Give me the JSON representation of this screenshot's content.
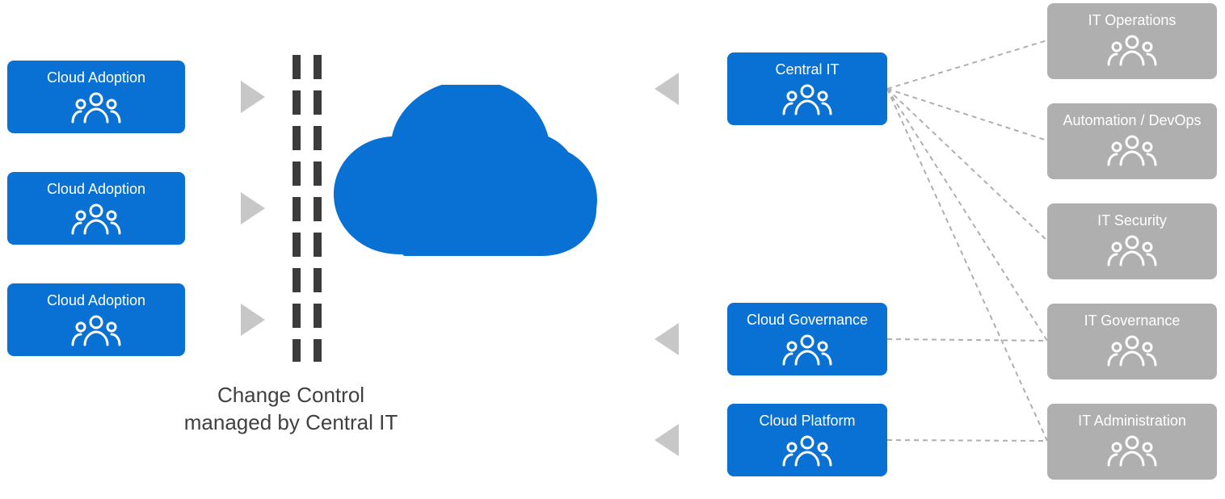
{
  "colors": {
    "blue": "#0871d3",
    "gray": "#afafaf",
    "arrow": "#c7c7c7",
    "dash": "#3b3b3b"
  },
  "left_boxes": [
    {
      "label": "Cloud Adoption"
    },
    {
      "label": "Cloud Adoption"
    },
    {
      "label": "Cloud Adoption"
    }
  ],
  "caption": "Change Control\nmanaged by\nCentral IT",
  "mid_boxes": [
    {
      "label": "Central IT"
    },
    {
      "label": "Cloud Governance"
    },
    {
      "label": "Cloud Platform"
    }
  ],
  "right_boxes": [
    {
      "label": "IT Operations"
    },
    {
      "label": "Automation / DevOps"
    },
    {
      "label": "IT Security"
    },
    {
      "label": "IT Governance"
    },
    {
      "label": "IT Administration"
    }
  ]
}
